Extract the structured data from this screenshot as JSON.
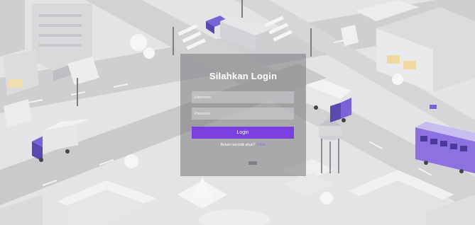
{
  "login": {
    "title": "Silahkan Login",
    "username_placeholder": "Username",
    "password_placeholder": "Password",
    "button_label": "Login",
    "register_prompt": "Belum memiliki akun?",
    "register_link": "Daftar"
  },
  "colors": {
    "accent": "#7b3fe0",
    "link": "#9b6bff",
    "panel": "#78787c"
  },
  "icons": {
    "background": "isometric-city-illustration"
  }
}
